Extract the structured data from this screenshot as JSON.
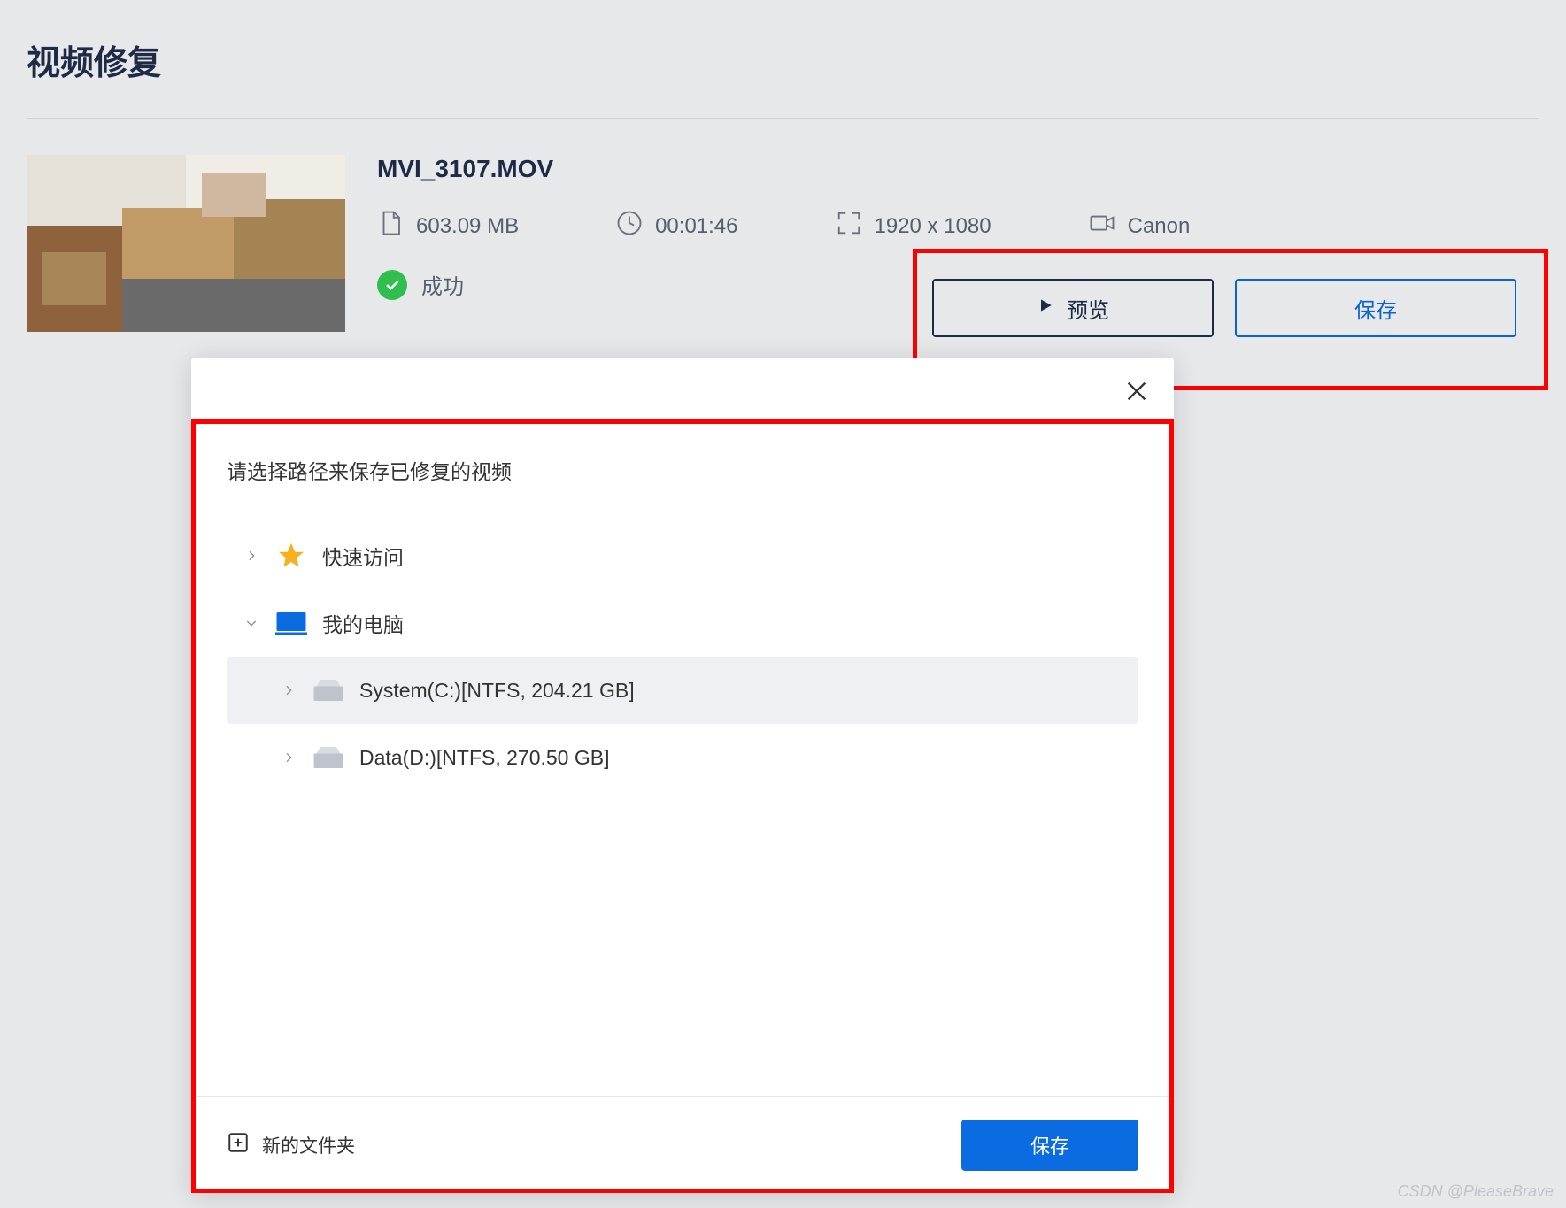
{
  "header": {
    "title": "视频修复"
  },
  "video": {
    "filename": "MVI_3107.MOV",
    "size": "603.09  MB",
    "duration": "00:01:46",
    "resolution": "1920 x 1080",
    "camera": "Canon",
    "status": "成功"
  },
  "actions": {
    "preview": "预览",
    "save": "保存"
  },
  "dialog": {
    "title": "请选择路径来保存已修复的视频",
    "tree": {
      "quick_access": "快速访问",
      "my_computer": "我的电脑",
      "drives": [
        {
          "label": "System(C:)[NTFS, 204.21  GB]",
          "selected": true
        },
        {
          "label": "Data(D:)[NTFS, 270.50  GB]",
          "selected": false
        }
      ]
    },
    "footer": {
      "new_folder": "新的文件夹",
      "save": "保存"
    }
  },
  "watermark": "CSDN @PleaseBrave"
}
